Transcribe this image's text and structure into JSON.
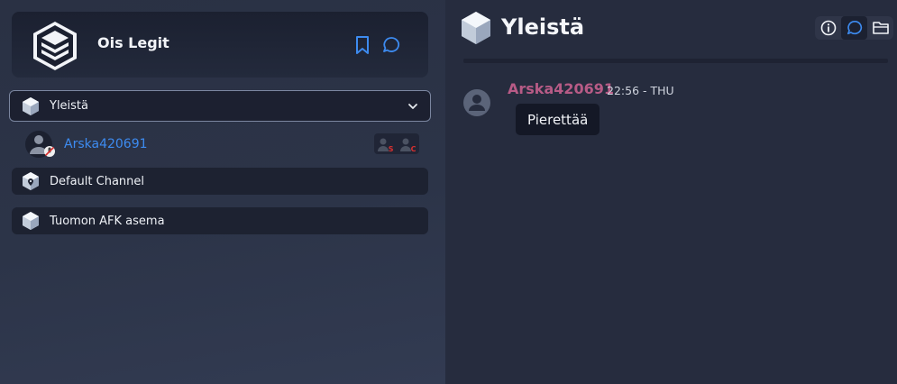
{
  "server": {
    "name": "Ois Legit",
    "logo_icon": "stack-layers-icon",
    "bookmark_icon": "bookmark-icon",
    "chat_icon": "chat-bubble-icon"
  },
  "channels": {
    "active": {
      "label": "Yleistä",
      "icon": "cube-icon",
      "expand_icon": "chevron-down-icon"
    },
    "users": [
      {
        "name": "Arska420691",
        "status_icons": [
          {
            "icon": "speaker-muted-icon",
            "letter": "S"
          },
          {
            "icon": "mic-muted-icon",
            "letter": "C"
          }
        ]
      }
    ],
    "others": [
      {
        "label": "Default Channel",
        "icon": "location-cube-icon"
      },
      {
        "label": "Tuomon AFK asema",
        "icon": "cube-icon"
      }
    ]
  },
  "chat": {
    "title": "Yleistä",
    "tools": [
      "info-icon",
      "chat-bubble-icon",
      "folder-icon"
    ],
    "messages": [
      {
        "author": "Arska420691",
        "time": "22:56 - THU",
        "text": "Pierettää"
      }
    ]
  },
  "colors": {
    "accent": "#3d8bf0",
    "author": "#b75b86",
    "muted_red": "#d93030"
  }
}
